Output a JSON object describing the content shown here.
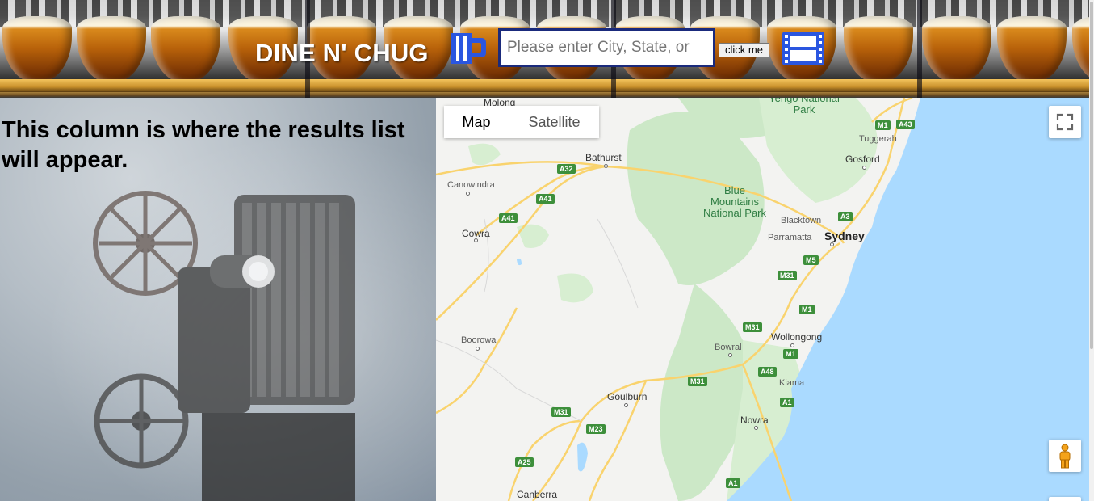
{
  "header": {
    "title": "DINE N' CHUG",
    "search_placeholder": "Please enter City, State, or",
    "search_value": "",
    "button_label": "click me"
  },
  "left_column": {
    "text": "This column is where the results list will appear."
  },
  "map": {
    "map_type_map": "Map",
    "map_type_satellite": "Satellite",
    "labels": {
      "molong": "Molong",
      "bathurst": "Bathurst",
      "canowindra": "Canowindra",
      "cowra": "Cowra",
      "boorowa": "Boorowa",
      "goulburn": "Goulburn",
      "canberra": "Canberra",
      "bowral": "Bowral",
      "nowra": "Nowra",
      "kiama": "Kiama",
      "wollongong": "Wollongong",
      "sydney": "Sydney",
      "parramatta": "Parramatta",
      "blacktown": "Blacktown",
      "gosford": "Gosford",
      "tuggerah": "Tuggerah",
      "blue_mountains": "Blue Mountains National Park",
      "yengo": "Yengo National Park"
    },
    "shields": {
      "a32": "A32",
      "a41_1": "A41",
      "a41_2": "A41",
      "m1_1": "M1",
      "a43": "A43",
      "a3": "A3",
      "m5": "M5",
      "m31_1": "M31",
      "m1_2": "M1",
      "m31_2": "M31",
      "m1_3": "M1",
      "a48": "A48",
      "m31_3": "M31",
      "a1_1": "A1",
      "m31_4": "M31",
      "m23": "M23",
      "a25": "A25",
      "a1_2": "A1"
    }
  },
  "colors": {
    "water": "#aadaff",
    "land": "#f3f3f1",
    "park": "#cce8c7",
    "road": "#f9d36e",
    "shield": "#3d8f3b",
    "icon_blue": "#2a56e0",
    "input_border": "#1a2a7c"
  }
}
